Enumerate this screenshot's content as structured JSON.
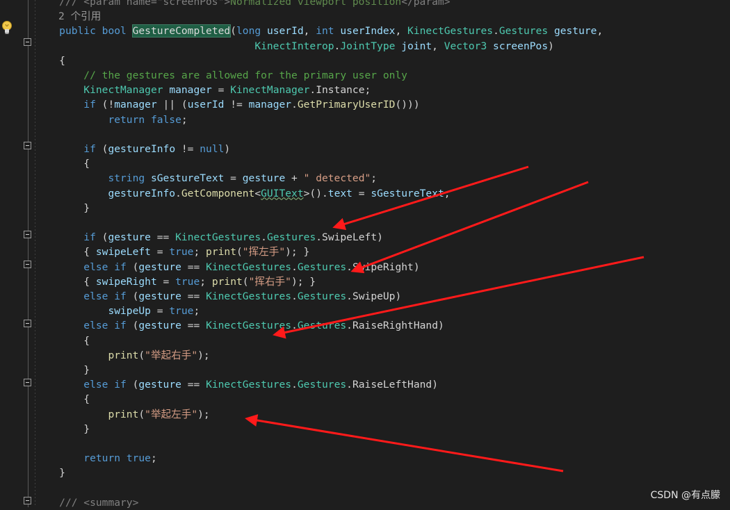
{
  "editor": {
    "code_lens": "2 个引用",
    "lines": [
      {
        "id": "doc-param-line",
        "indent": "    ",
        "tokens": [
          {
            "c": "xd",
            "t": "/// <param name=\"screenPos\">"
          },
          {
            "c": "xm",
            "t": "Normalized viewport position"
          },
          {
            "c": "xd",
            "t": "</param>"
          }
        ]
      },
      {
        "id": "signature-line-1",
        "indent": "    ",
        "tokens": [
          {
            "c": "kw",
            "t": "public "
          },
          {
            "c": "kw",
            "t": "bool "
          },
          {
            "c": "fn hl",
            "t": "GestureCompleted"
          },
          {
            "c": "pl",
            "t": "("
          },
          {
            "c": "kw",
            "t": "long "
          },
          {
            "c": "pa",
            "t": "userId"
          },
          {
            "c": "pl",
            "t": ", "
          },
          {
            "c": "kw",
            "t": "int "
          },
          {
            "c": "pa",
            "t": "userIndex"
          },
          {
            "c": "pl",
            "t": ", "
          },
          {
            "c": "ty",
            "t": "KinectGestures"
          },
          {
            "c": "pl",
            "t": "."
          },
          {
            "c": "ty",
            "t": "Gestures "
          },
          {
            "c": "pa",
            "t": "gesture"
          },
          {
            "c": "pl",
            "t": ","
          }
        ]
      },
      {
        "id": "signature-line-2",
        "indent": "                                    ",
        "tokens": [
          {
            "c": "ty",
            "t": "KinectInterop"
          },
          {
            "c": "pl",
            "t": "."
          },
          {
            "c": "ty",
            "t": "JointType "
          },
          {
            "c": "pa",
            "t": "joint"
          },
          {
            "c": "pl",
            "t": ", "
          },
          {
            "c": "ty",
            "t": "Vector3 "
          },
          {
            "c": "pa",
            "t": "screenPos"
          },
          {
            "c": "pl",
            "t": ")"
          }
        ]
      },
      {
        "id": "open-brace",
        "indent": "    ",
        "tokens": [
          {
            "c": "pl",
            "t": "{"
          }
        ]
      },
      {
        "id": "comment-line",
        "indent": "        ",
        "tokens": [
          {
            "c": "cm",
            "t": "// the gestures are allowed for the primary user only"
          }
        ]
      },
      {
        "id": "manager-line",
        "indent": "        ",
        "tokens": [
          {
            "c": "ty",
            "t": "KinectManager "
          },
          {
            "c": "pa",
            "t": "manager"
          },
          {
            "c": "pl",
            "t": " = "
          },
          {
            "c": "ty",
            "t": "KinectManager"
          },
          {
            "c": "pl",
            "t": "."
          },
          {
            "c": "pl",
            "t": "Instance;"
          }
        ]
      },
      {
        "id": "if-manager-line",
        "indent": "        ",
        "tokens": [
          {
            "c": "kw",
            "t": "if "
          },
          {
            "c": "pl",
            "t": "(!"
          },
          {
            "c": "pa",
            "t": "manager"
          },
          {
            "c": "pl",
            "t": " || ("
          },
          {
            "c": "pa",
            "t": "userId"
          },
          {
            "c": "pl",
            "t": " != "
          },
          {
            "c": "pa",
            "t": "manager"
          },
          {
            "c": "pl",
            "t": "."
          },
          {
            "c": "fn",
            "t": "GetPrimaryUserID"
          },
          {
            "c": "pl",
            "t": "()))"
          }
        ]
      },
      {
        "id": "return-false-line",
        "indent": "            ",
        "tokens": [
          {
            "c": "kw",
            "t": "return "
          },
          {
            "c": "kw",
            "t": "false"
          },
          {
            "c": "pl",
            "t": ";"
          }
        ]
      },
      {
        "id": "blank-1",
        "indent": "",
        "tokens": []
      },
      {
        "id": "if-gestureinfo-line",
        "indent": "        ",
        "tokens": [
          {
            "c": "kw",
            "t": "if "
          },
          {
            "c": "pl",
            "t": "("
          },
          {
            "c": "pa",
            "t": "gestureInfo"
          },
          {
            "c": "pl",
            "t": " != "
          },
          {
            "c": "kw",
            "t": "null"
          },
          {
            "c": "pl",
            "t": ")"
          }
        ]
      },
      {
        "id": "brace-open-2",
        "indent": "        ",
        "tokens": [
          {
            "c": "pl",
            "t": "{"
          }
        ]
      },
      {
        "id": "string-line",
        "indent": "            ",
        "tokens": [
          {
            "c": "kw",
            "t": "string "
          },
          {
            "c": "pa",
            "t": "sGestureText"
          },
          {
            "c": "pl",
            "t": " = "
          },
          {
            "c": "pa",
            "t": "gesture"
          },
          {
            "c": "pl",
            "t": " + "
          },
          {
            "c": "st",
            "t": "\" detected\""
          },
          {
            "c": "pl",
            "t": ";"
          }
        ]
      },
      {
        "id": "getcomponent-line",
        "indent": "            ",
        "tokens": [
          {
            "c": "pa",
            "t": "gestureInfo"
          },
          {
            "c": "pl",
            "t": "."
          },
          {
            "c": "fn",
            "t": "GetComponent"
          },
          {
            "c": "pl",
            "t": "<"
          },
          {
            "c": "ty sq",
            "t": "GUIText"
          },
          {
            "c": "pl",
            "t": ">()."
          },
          {
            "c": "pa",
            "t": "text"
          },
          {
            "c": "pl",
            "t": " = "
          },
          {
            "c": "pa",
            "t": "sGestureText"
          },
          {
            "c": "pl",
            "t": ";"
          }
        ]
      },
      {
        "id": "brace-close-2",
        "indent": "        ",
        "tokens": [
          {
            "c": "pl",
            "t": "}"
          }
        ]
      },
      {
        "id": "blank-2",
        "indent": "",
        "tokens": []
      },
      {
        "id": "if-swipeleft-line",
        "indent": "        ",
        "tokens": [
          {
            "c": "kw",
            "t": "if "
          },
          {
            "c": "pl",
            "t": "("
          },
          {
            "c": "pa",
            "t": "gesture"
          },
          {
            "c": "pl",
            "t": " == "
          },
          {
            "c": "ty",
            "t": "KinectGestures"
          },
          {
            "c": "pl",
            "t": "."
          },
          {
            "c": "ty",
            "t": "Gestures"
          },
          {
            "c": "pl",
            "t": "."
          },
          {
            "c": "pl",
            "t": "SwipeLeft)"
          }
        ]
      },
      {
        "id": "swipeleft-body-line",
        "indent": "        ",
        "tokens": [
          {
            "c": "pl",
            "t": "{ "
          },
          {
            "c": "pa",
            "t": "swipeLeft"
          },
          {
            "c": "pl",
            "t": " = "
          },
          {
            "c": "kw",
            "t": "true"
          },
          {
            "c": "pl",
            "t": "; "
          },
          {
            "c": "fn",
            "t": "print"
          },
          {
            "c": "pl",
            "t": "("
          },
          {
            "c": "st",
            "t": "\"挥左手\""
          },
          {
            "c": "pl",
            "t": "); }"
          }
        ]
      },
      {
        "id": "elseif-swiperight-line",
        "indent": "        ",
        "tokens": [
          {
            "c": "kw",
            "t": "else if "
          },
          {
            "c": "pl",
            "t": "("
          },
          {
            "c": "pa",
            "t": "gesture"
          },
          {
            "c": "pl",
            "t": " == "
          },
          {
            "c": "ty",
            "t": "KinectGestures"
          },
          {
            "c": "pl",
            "t": "."
          },
          {
            "c": "ty",
            "t": "Gestures"
          },
          {
            "c": "pl",
            "t": "."
          },
          {
            "c": "pl",
            "t": "SwipeRight)"
          }
        ]
      },
      {
        "id": "swiperight-body-line",
        "indent": "        ",
        "tokens": [
          {
            "c": "pl",
            "t": "{ "
          },
          {
            "c": "pa",
            "t": "swipeRight"
          },
          {
            "c": "pl",
            "t": " = "
          },
          {
            "c": "kw",
            "t": "true"
          },
          {
            "c": "pl",
            "t": "; "
          },
          {
            "c": "fn",
            "t": "print"
          },
          {
            "c": "pl",
            "t": "("
          },
          {
            "c": "st",
            "t": "\"挥右手\""
          },
          {
            "c": "pl",
            "t": "); }"
          }
        ]
      },
      {
        "id": "elseif-swipeup-line",
        "indent": "        ",
        "tokens": [
          {
            "c": "kw",
            "t": "else if "
          },
          {
            "c": "pl",
            "t": "("
          },
          {
            "c": "pa",
            "t": "gesture"
          },
          {
            "c": "pl",
            "t": " == "
          },
          {
            "c": "ty",
            "t": "KinectGestures"
          },
          {
            "c": "pl",
            "t": "."
          },
          {
            "c": "ty",
            "t": "Gestures"
          },
          {
            "c": "pl",
            "t": "."
          },
          {
            "c": "pl",
            "t": "SwipeUp)"
          }
        ]
      },
      {
        "id": "swipeup-body-line",
        "indent": "            ",
        "tokens": [
          {
            "c": "pa",
            "t": "swipeUp"
          },
          {
            "c": "pl",
            "t": " = "
          },
          {
            "c": "kw",
            "t": "true"
          },
          {
            "c": "pl",
            "t": ";"
          }
        ]
      },
      {
        "id": "elseif-raiseright-line",
        "indent": "        ",
        "tokens": [
          {
            "c": "kw",
            "t": "else if "
          },
          {
            "c": "pl",
            "t": "("
          },
          {
            "c": "pa",
            "t": "gesture"
          },
          {
            "c": "pl",
            "t": " == "
          },
          {
            "c": "ty",
            "t": "KinectGestures"
          },
          {
            "c": "pl",
            "t": "."
          },
          {
            "c": "ty",
            "t": "Gestures"
          },
          {
            "c": "pl",
            "t": "."
          },
          {
            "c": "pl",
            "t": "RaiseRightHand)"
          }
        ]
      },
      {
        "id": "brace-open-3",
        "indent": "        ",
        "tokens": [
          {
            "c": "pl",
            "t": "{"
          }
        ]
      },
      {
        "id": "print-raiseright-line",
        "indent": "            ",
        "tokens": [
          {
            "c": "fn",
            "t": "print"
          },
          {
            "c": "pl",
            "t": "("
          },
          {
            "c": "st",
            "t": "\"举起右手\""
          },
          {
            "c": "pl",
            "t": ");"
          }
        ]
      },
      {
        "id": "brace-close-3",
        "indent": "        ",
        "tokens": [
          {
            "c": "pl",
            "t": "}"
          }
        ]
      },
      {
        "id": "elseif-raiseleft-line",
        "indent": "        ",
        "tokens": [
          {
            "c": "kw",
            "t": "else if "
          },
          {
            "c": "pl",
            "t": "("
          },
          {
            "c": "pa",
            "t": "gesture"
          },
          {
            "c": "pl",
            "t": " == "
          },
          {
            "c": "ty",
            "t": "KinectGestures"
          },
          {
            "c": "pl",
            "t": "."
          },
          {
            "c": "ty",
            "t": "Gestures"
          },
          {
            "c": "pl",
            "t": "."
          },
          {
            "c": "pl",
            "t": "RaiseLeftHand)"
          }
        ]
      },
      {
        "id": "brace-open-4",
        "indent": "        ",
        "tokens": [
          {
            "c": "pl",
            "t": "{"
          }
        ]
      },
      {
        "id": "print-raiseleft-line",
        "indent": "            ",
        "tokens": [
          {
            "c": "fn",
            "t": "print"
          },
          {
            "c": "pl",
            "t": "("
          },
          {
            "c": "st",
            "t": "\"举起左手\""
          },
          {
            "c": "pl",
            "t": ");"
          }
        ]
      },
      {
        "id": "brace-close-4",
        "indent": "        ",
        "tokens": [
          {
            "c": "pl",
            "t": "}"
          }
        ]
      },
      {
        "id": "blank-3",
        "indent": "",
        "tokens": []
      },
      {
        "id": "return-true-line",
        "indent": "        ",
        "tokens": [
          {
            "c": "kw",
            "t": "return "
          },
          {
            "c": "kw",
            "t": "true"
          },
          {
            "c": "pl",
            "t": ";"
          }
        ]
      },
      {
        "id": "close-brace",
        "indent": "    ",
        "tokens": [
          {
            "c": "pl",
            "t": "}"
          }
        ]
      },
      {
        "id": "blank-4",
        "indent": "",
        "tokens": []
      },
      {
        "id": "doc-summary-line",
        "indent": "    ",
        "tokens": [
          {
            "c": "xd",
            "t": "/// <summary>"
          }
        ]
      }
    ]
  },
  "watermark": "CSDN @有点朦",
  "colors": {
    "background": "#1e1e1e",
    "annotation_arrow": "#ff1a1a",
    "method_highlight": "#1f5e44"
  },
  "icons": [
    "lightbulb-icon",
    "collapse-icon",
    "annotation-arrow"
  ]
}
